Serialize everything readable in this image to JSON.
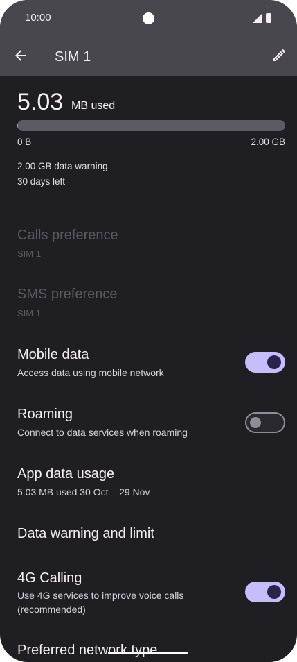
{
  "status_bar": {
    "time": "10:00"
  },
  "app_bar": {
    "title": "SIM 1"
  },
  "usage": {
    "amount": "5.03",
    "unit": "MB used",
    "progress_fraction": 0.0025,
    "range_min": "0 B",
    "range_max": "2.00 GB",
    "warning": "2.00 GB data warning",
    "days_left": "30 days left"
  },
  "preferences": {
    "calls": {
      "title": "Calls preference",
      "value": "SIM 1"
    },
    "sms": {
      "title": "SMS preference",
      "value": "SIM 1"
    }
  },
  "settings": {
    "mobile_data": {
      "title": "Mobile data",
      "subtitle": "Access data using mobile network",
      "enabled": true
    },
    "roaming": {
      "title": "Roaming",
      "subtitle": "Connect to data services when roaming",
      "enabled": false
    },
    "app_data_usage": {
      "title": "App data usage",
      "subtitle": "5.03 MB used 30 Oct – 29 Nov"
    },
    "data_warning": {
      "title": "Data warning and limit"
    },
    "calling_4g": {
      "title": "4G Calling",
      "subtitle_line1": "Use 4G services to improve voice calls",
      "subtitle_line2": "(recommended)",
      "enabled": true
    },
    "preferred_network": {
      "title": "Preferred network type"
    }
  },
  "colors": {
    "accent": "#c6bdfb",
    "background": "#1f1e23",
    "app_bar": "#48474d"
  },
  "icons": {
    "back": "arrow-left",
    "edit": "pencil"
  }
}
